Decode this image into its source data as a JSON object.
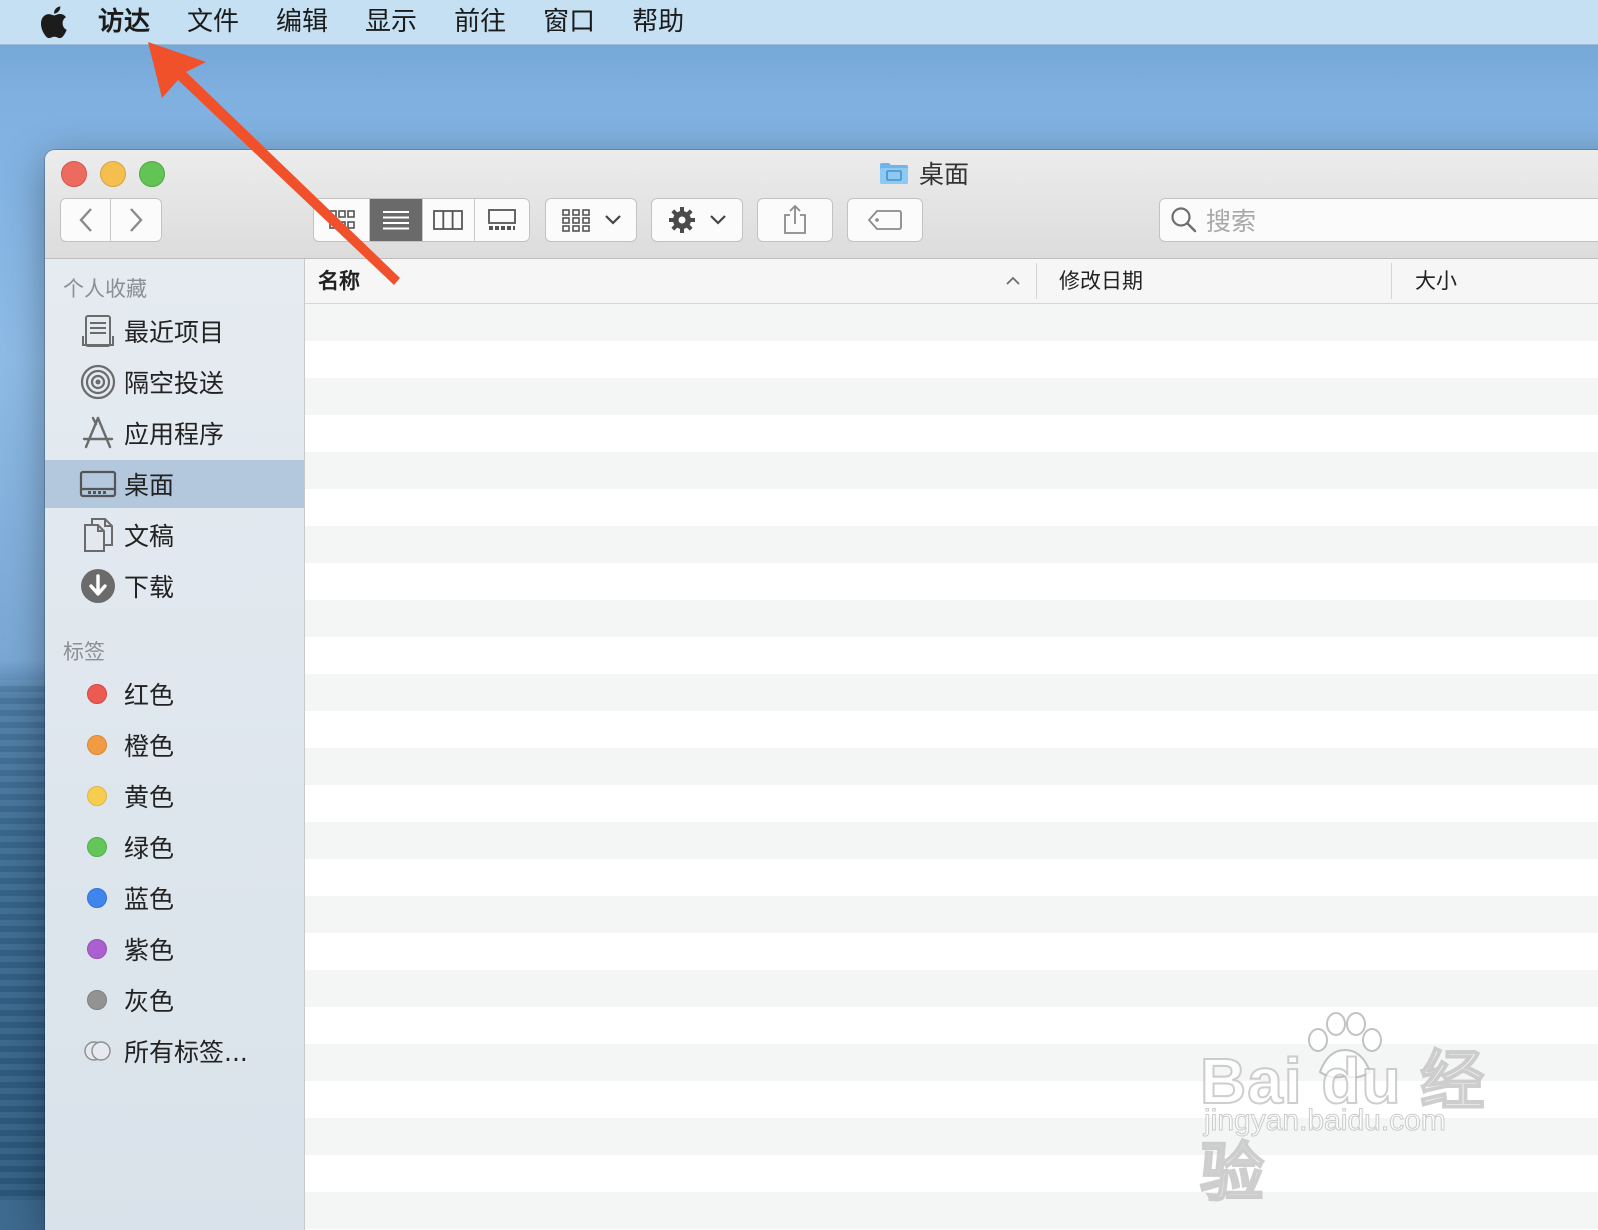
{
  "menubar": {
    "items": [
      "访达",
      "文件",
      "编辑",
      "显示",
      "前往",
      "窗口",
      "帮助"
    ]
  },
  "window": {
    "title": "桌面",
    "search": {
      "placeholder": "搜索"
    }
  },
  "sidebar": {
    "favorites_title": "个人收藏",
    "favorites": [
      {
        "label": "最近项目",
        "icon": "recents-icon"
      },
      {
        "label": "隔空投送",
        "icon": "airdrop-icon"
      },
      {
        "label": "应用程序",
        "icon": "applications-icon"
      },
      {
        "label": "桌面",
        "icon": "desktop-icon",
        "selected": true
      },
      {
        "label": "文稿",
        "icon": "documents-icon"
      },
      {
        "label": "下载",
        "icon": "downloads-icon"
      }
    ],
    "tags_title": "标签",
    "tags": [
      {
        "label": "红色",
        "color": "#ec5a52"
      },
      {
        "label": "橙色",
        "color": "#f19a44"
      },
      {
        "label": "黄色",
        "color": "#f6cd4e"
      },
      {
        "label": "绿色",
        "color": "#64c65a"
      },
      {
        "label": "蓝色",
        "color": "#3f85ee"
      },
      {
        "label": "紫色",
        "color": "#ac5fd0"
      },
      {
        "label": "灰色",
        "color": "#939393"
      },
      {
        "label": "所有标签...",
        "color": ""
      }
    ]
  },
  "list": {
    "columns": [
      "名称",
      "修改日期",
      "大小"
    ],
    "sort_indicator": "ascending"
  },
  "watermark": {
    "brand": "Bai du 经验",
    "url": "jingyan.baidu.com"
  },
  "annotation": {
    "color": "#f0502a"
  }
}
